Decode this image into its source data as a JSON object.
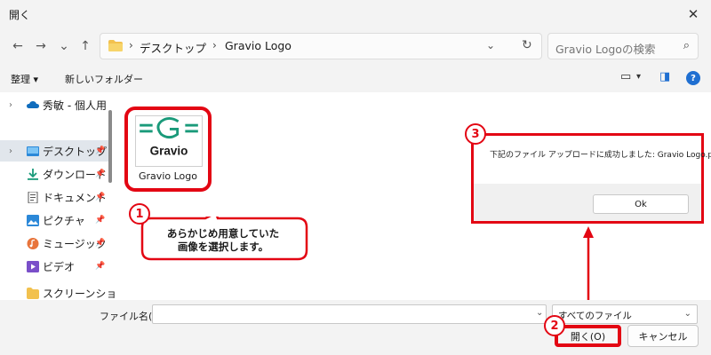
{
  "window": {
    "title": "開く",
    "close_glyph": "✕"
  },
  "nav": {
    "back_glyph": "←",
    "forward_glyph": "→",
    "recent_glyph": "⌄",
    "up_glyph": "↑",
    "breadcrumb": [
      "デスクトップ",
      "Gravio Logo"
    ],
    "separator": "›",
    "dropdown_glyph": "⌄",
    "refresh_glyph": "↻",
    "search_placeholder": "Gravio Logoの検索",
    "search_glyph": "⌕"
  },
  "commandbar": {
    "organize_label": "整理 ▾",
    "new_folder_label": "新しいフォルダー",
    "view_glyph": "▭",
    "view_dropdown_glyph": "▾",
    "preview_glyph": "◨",
    "help_glyph": "?"
  },
  "sidebar": {
    "items": [
      {
        "label": "秀敏 - 個人用",
        "expander": "›",
        "icon": "cloud-icon",
        "pinned": false,
        "selected": false
      },
      {
        "label": "デスクトップ",
        "expander": "›",
        "icon": "desktop-icon",
        "pinned": true,
        "selected": true
      },
      {
        "label": "ダウンロード",
        "expander": "",
        "icon": "download-icon",
        "pinned": true,
        "selected": false
      },
      {
        "label": "ドキュメント",
        "expander": "",
        "icon": "document-icon",
        "pinned": true,
        "selected": false
      },
      {
        "label": "ピクチャ",
        "expander": "",
        "icon": "pictures-icon",
        "pinned": true,
        "selected": false
      },
      {
        "label": "ミュージック",
        "expander": "",
        "icon": "music-icon",
        "pinned": true,
        "selected": false
      },
      {
        "label": "ビデオ",
        "expander": "",
        "icon": "video-icon",
        "pinned": true,
        "selected": false
      },
      {
        "label": "スクリーンショット",
        "expander": "",
        "icon": "folder-icon",
        "pinned": false,
        "selected": false
      }
    ],
    "pin_glyph": "📌"
  },
  "file": {
    "name": "Gravio Logo",
    "thumb_text": "Gravio",
    "colors": {
      "logo_green": "#1a9a7a",
      "thumb_text": "#1a1a1a"
    }
  },
  "callouts": {
    "one": {
      "number": "1",
      "line1": "あらかじめ用意していた",
      "line2": "画像を選択します。"
    },
    "two": {
      "number": "2"
    },
    "three": {
      "number": "3"
    }
  },
  "message": {
    "text": "下記のファイル アップロードに成功しました: Gravio Logo.png",
    "ok_label": "Ok"
  },
  "bottom": {
    "filename_label": "ファイル名(N):",
    "filename_value": "",
    "filename_dropdown_glyph": "⌄",
    "filetype_value": "すべてのファイル",
    "filetype_dropdown_glyph": "⌄",
    "open_label": "開く(O)",
    "cancel_label": "キャンセル"
  },
  "colors": {
    "accent_red": "#e30613",
    "help_blue": "#1f6fd1",
    "selected_bg": "#e1e6ec"
  }
}
